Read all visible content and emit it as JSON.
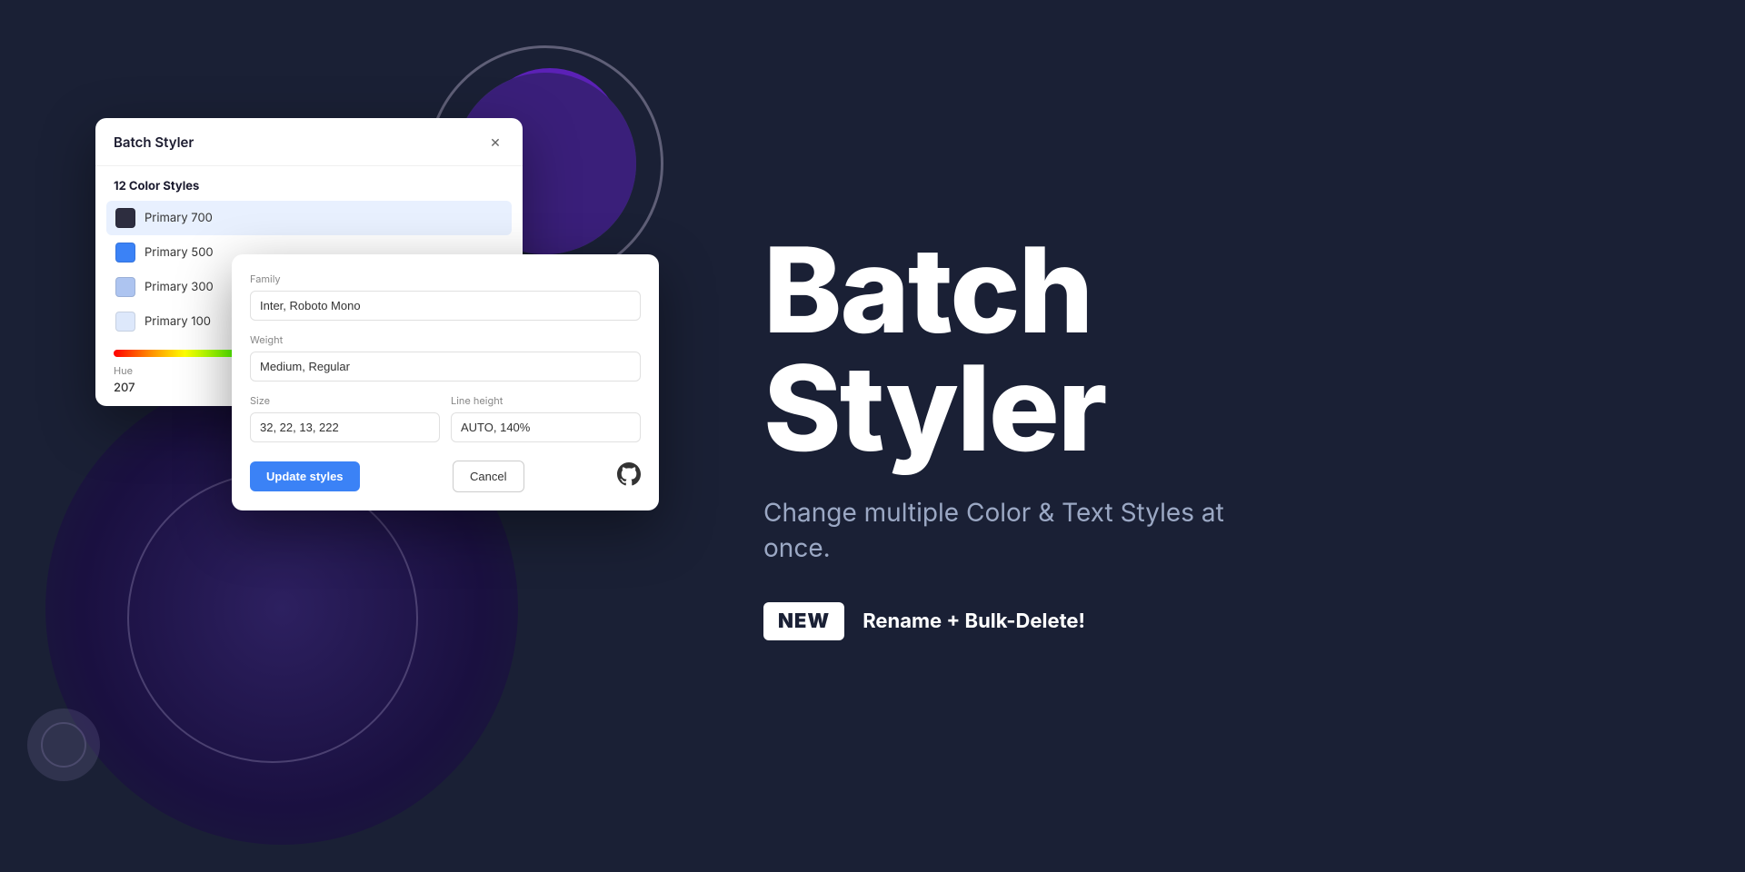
{
  "left": {
    "dialog": {
      "title": "Batch Styler",
      "close_label": "×",
      "color_styles_count": "12 Color Styles",
      "color_items": [
        {
          "name": "Primary 700",
          "color": "#2d2d3f",
          "selected": true
        },
        {
          "name": "Primary 500",
          "color": "#3b82f6",
          "selected": false
        },
        {
          "name": "Primary 300",
          "color": "#adc4f0",
          "selected": false
        },
        {
          "name": "Primary 100",
          "color": "#dde8fb",
          "selected": false
        }
      ],
      "hue_label": "Hue",
      "hue_value": "207"
    },
    "properties": {
      "family_label": "Family",
      "family_value": "Inter, Roboto Mono",
      "weight_label": "Weight",
      "weight_value": "Medium, Regular",
      "size_label": "Size",
      "size_value": "32, 22, 13, 222",
      "line_height_label": "Line height",
      "line_height_value": "AUTO, 140%",
      "update_button": "Update styles",
      "cancel_button": "Cancel"
    }
  },
  "right": {
    "heading_line1": "Batch",
    "heading_line2": "Styler",
    "subtitle": "Change multiple Color & Text Styles at once.",
    "badge_new": "NEW",
    "badge_text": "Rename + Bulk-Delete!"
  }
}
